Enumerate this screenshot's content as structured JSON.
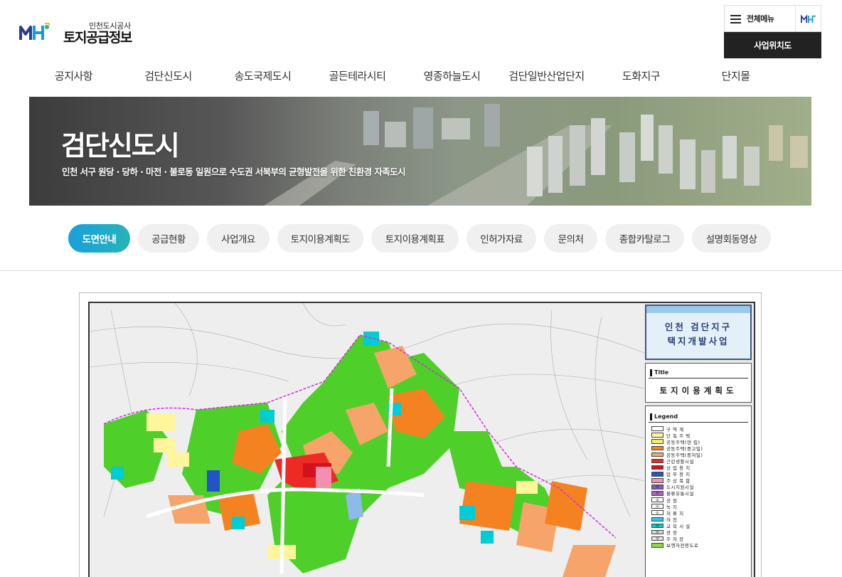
{
  "header": {
    "logo_org": "인천도시공사",
    "logo_title": "토지공급정보",
    "menu_label": "전체메뉴",
    "location_label": "사업위치도"
  },
  "gnb": [
    "공지사항",
    "검단신도시",
    "송도국제도시",
    "골든테라시티",
    "영종하늘도시",
    "검단일반산업단지",
    "도화지구",
    "단지몰"
  ],
  "hero": {
    "title": "검단신도시",
    "subtitle": "인천 서구 원당 · 당하 · 마전 · 불로동 일원으로 수도권 서북부의 균형발전을 위한 친환경 자족도시"
  },
  "tabs": [
    {
      "label": "도면안내",
      "active": true
    },
    {
      "label": "공급현황",
      "active": false
    },
    {
      "label": "사업개요",
      "active": false
    },
    {
      "label": "토지이용계획도",
      "active": false
    },
    {
      "label": "토지이용계획표",
      "active": false
    },
    {
      "label": "인허가자료",
      "active": false
    },
    {
      "label": "문의처",
      "active": false
    },
    {
      "label": "종합카탈로그",
      "active": false
    },
    {
      "label": "설명회동영상",
      "active": false
    }
  ],
  "map": {
    "name_line1": "인천 검단지구",
    "name_line2": "택지개발사업",
    "title_heading": "Title",
    "title_value": "토지이용계획도",
    "legend_heading": "Legend",
    "legend": [
      {
        "label": "구 역 계",
        "color": "#ffffff",
        "mark": ""
      },
      {
        "label": "단 독 주 택",
        "color": "#fff59a",
        "mark": ""
      },
      {
        "label": "공동주택(연 립)",
        "color": "#f6e96b",
        "mark": ""
      },
      {
        "label": "공동주택(중고밀)",
        "color": "#f58220",
        "mark": ""
      },
      {
        "label": "공동주택(중저밀)",
        "color": "#f6a46a",
        "mark": ""
      },
      {
        "label": "근린생활시설",
        "color": "#ee2a24",
        "mark": ""
      },
      {
        "label": "상 업 용 지",
        "color": "#d4101d",
        "mark": ""
      },
      {
        "label": "업 무 용 지",
        "color": "#2254c8",
        "mark": ""
      },
      {
        "label": "주 상 복 합",
        "color": "#f48fb1",
        "mark": ""
      },
      {
        "label": "도시지원시설",
        "color": "#7b5fb8",
        "mark": "◎"
      },
      {
        "label": "물류유통시설",
        "color": "#b05fc8",
        "mark": "◎"
      },
      {
        "label": "공 원",
        "color": "#ffffff",
        "mark": "◎"
      },
      {
        "label": "녹 지",
        "color": "#ffffff",
        "mark": "◎"
      },
      {
        "label": "저 류 지",
        "color": "#ffffff",
        "mark": "◎"
      },
      {
        "label": "하 천",
        "color": "#2ec6ea",
        "mark": ""
      },
      {
        "label": "교 육 시 설",
        "color": "#00ccd6",
        "mark": "◎"
      },
      {
        "label": "광 장",
        "color": "#d8d8d8",
        "mark": "◎"
      },
      {
        "label": "주 차 장",
        "color": "#e8e8e8",
        "mark": "◎"
      },
      {
        "label": "보행자전용도로",
        "color": "#8bd64a",
        "mark": ""
      }
    ]
  },
  "colors": {
    "tab_active_start": "#1aa0dc",
    "tab_active_end": "#27b3b8",
    "location_button": "#222222"
  }
}
